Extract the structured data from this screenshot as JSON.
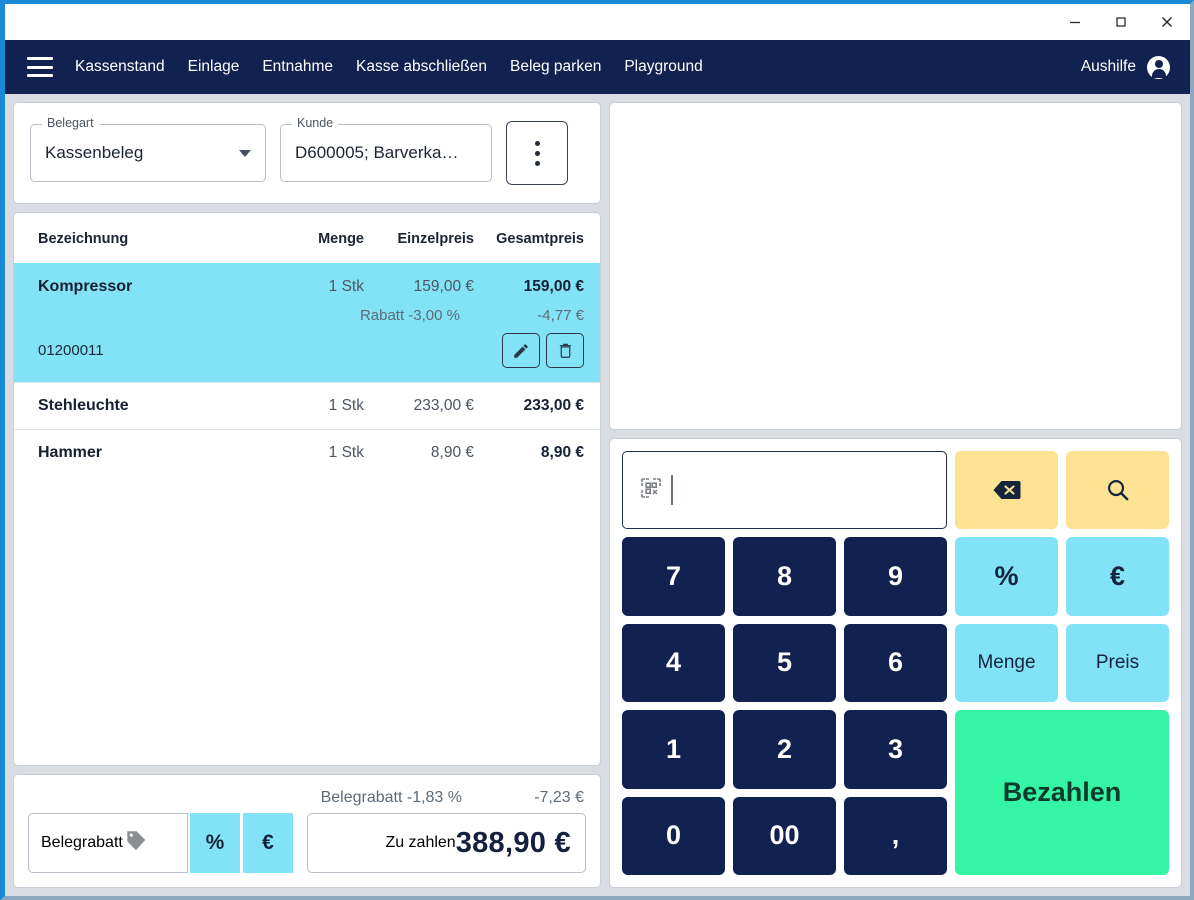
{
  "window": {
    "minimize_label": "minimize",
    "maximize_label": "maximize",
    "close_label": "close"
  },
  "nav": {
    "menu_icon": "hamburger-icon",
    "items": [
      {
        "label": "Kassenstand"
      },
      {
        "label": "Einlage"
      },
      {
        "label": "Entnahme"
      },
      {
        "label": "Kasse abschließen"
      },
      {
        "label": "Beleg parken"
      },
      {
        "label": "Playground"
      }
    ],
    "user": {
      "label": "Aushilfe",
      "icon": "account-circle-icon"
    }
  },
  "form": {
    "belegart": {
      "label": "Belegart",
      "value": "Kassenbeleg",
      "icon": "chevron-down-icon"
    },
    "kunde": {
      "label": "Kunde",
      "value": "D600005; Barverka…"
    },
    "more_button": {
      "icon": "kebab-menu-icon"
    }
  },
  "items_table": {
    "columns": [
      "Bezeichnung",
      "Menge",
      "Einzelpreis",
      "Gesamtpreis"
    ],
    "rows": [
      {
        "name": "Kompressor",
        "qty": "1 Stk",
        "unit_price": "159,00 €",
        "total_price": "159,00 €",
        "discount_label": "Rabatt -3,00 %",
        "discount_value": "-4,77 €",
        "article_no": "01200011",
        "selected": true,
        "edit_icon": "pencil-icon",
        "delete_icon": "trash-icon"
      },
      {
        "name": "Stehleuchte",
        "qty": "1 Stk",
        "unit_price": "233,00 €",
        "total_price": "233,00 €",
        "selected": false
      },
      {
        "name": "Hammer",
        "qty": "1 Stk",
        "unit_price": "8,90 €",
        "total_price": "8,90 €",
        "selected": false
      }
    ]
  },
  "totals": {
    "doc_discount_label": "Belegrabatt -1,83 %",
    "doc_discount_value": "-7,23 €",
    "discount_field": {
      "label": "Belegrabatt",
      "value": "",
      "icon": "price-tag-icon"
    },
    "percent_button": "%",
    "euro_button": "€",
    "payable": {
      "label": "Zu zahlen",
      "value": "388,90 €"
    }
  },
  "keypad": {
    "scan_input": {
      "icon": "qr-scan-icon",
      "value": "",
      "placeholder": ""
    },
    "backspace": {
      "icon": "backspace-icon"
    },
    "search": {
      "icon": "search-icon"
    },
    "keys": {
      "k7": "7",
      "k8": "8",
      "k9": "9",
      "k4": "4",
      "k5": "5",
      "k6": "6",
      "k1": "1",
      "k2": "2",
      "k3": "3",
      "k0": "0",
      "k00": "00",
      "kcomma": ","
    },
    "percent": "%",
    "euro": "€",
    "menge": "Menge",
    "preis": "Preis",
    "pay": "Bezahlen"
  },
  "colors": {
    "navy": "#122250",
    "cyan": "#82e3f7",
    "green": "#34f5a5",
    "yellow": "#fce394",
    "window_accent": "#1a8ad4",
    "page_bg": "#d9dde3"
  }
}
